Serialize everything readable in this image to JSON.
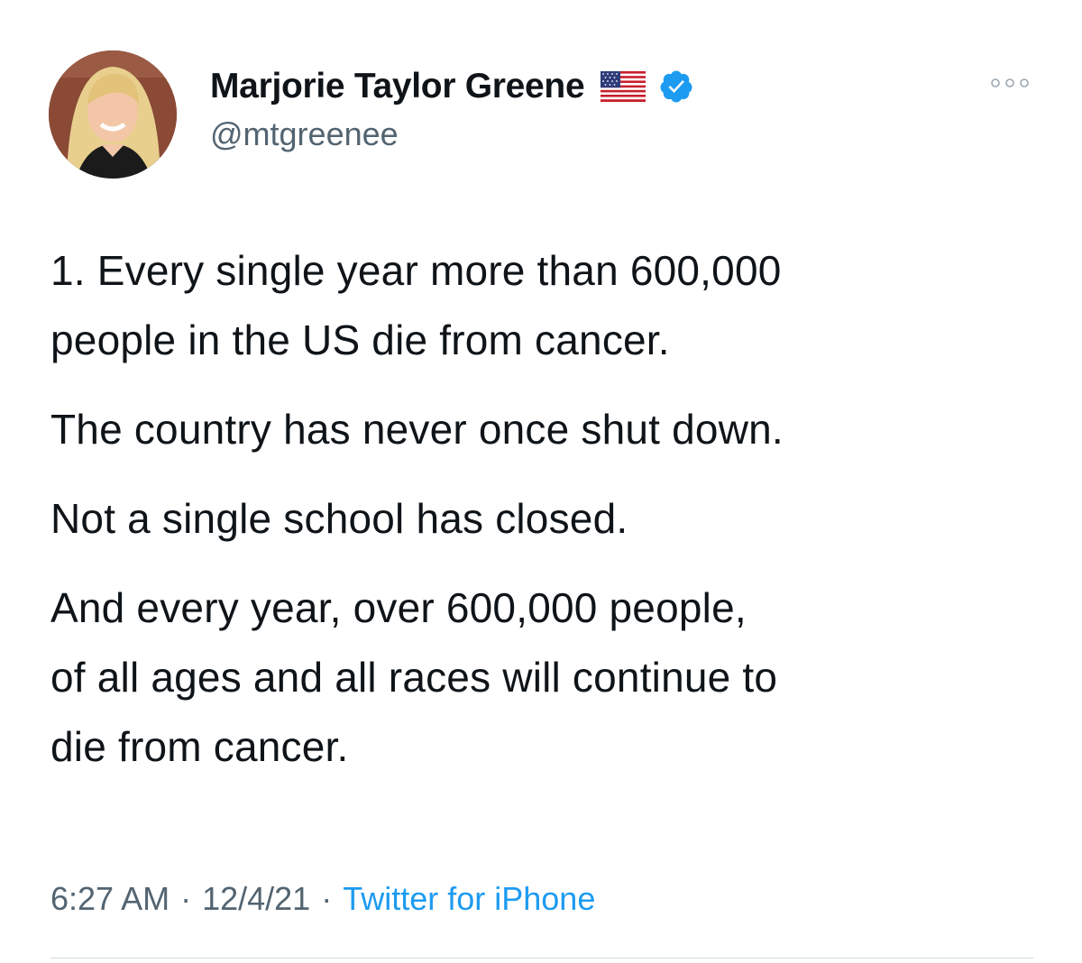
{
  "tweet": {
    "author": {
      "display_name": "Marjorie Taylor Greene",
      "handle": "@mtgreenee",
      "flag_icon": "us-flag-icon",
      "verified_icon": "verified-badge-icon"
    },
    "more_icon": "more-options-icon",
    "paragraphs": [
      "1. Every single year more than 600,000\npeople in the US die from cancer.",
      "The country has never once shut down.",
      "Not a single school has closed.",
      "And every year, over 600,000 people,\nof all ages and all races will continue to\ndie from cancer."
    ],
    "meta": {
      "time": "6:27 AM",
      "separator": "·",
      "date": "12/4/21",
      "source": "Twitter for iPhone"
    }
  },
  "colors": {
    "text": "#0f1419",
    "secondary": "#536471",
    "link": "#1d9bf0",
    "divider": "#cfd9de"
  }
}
